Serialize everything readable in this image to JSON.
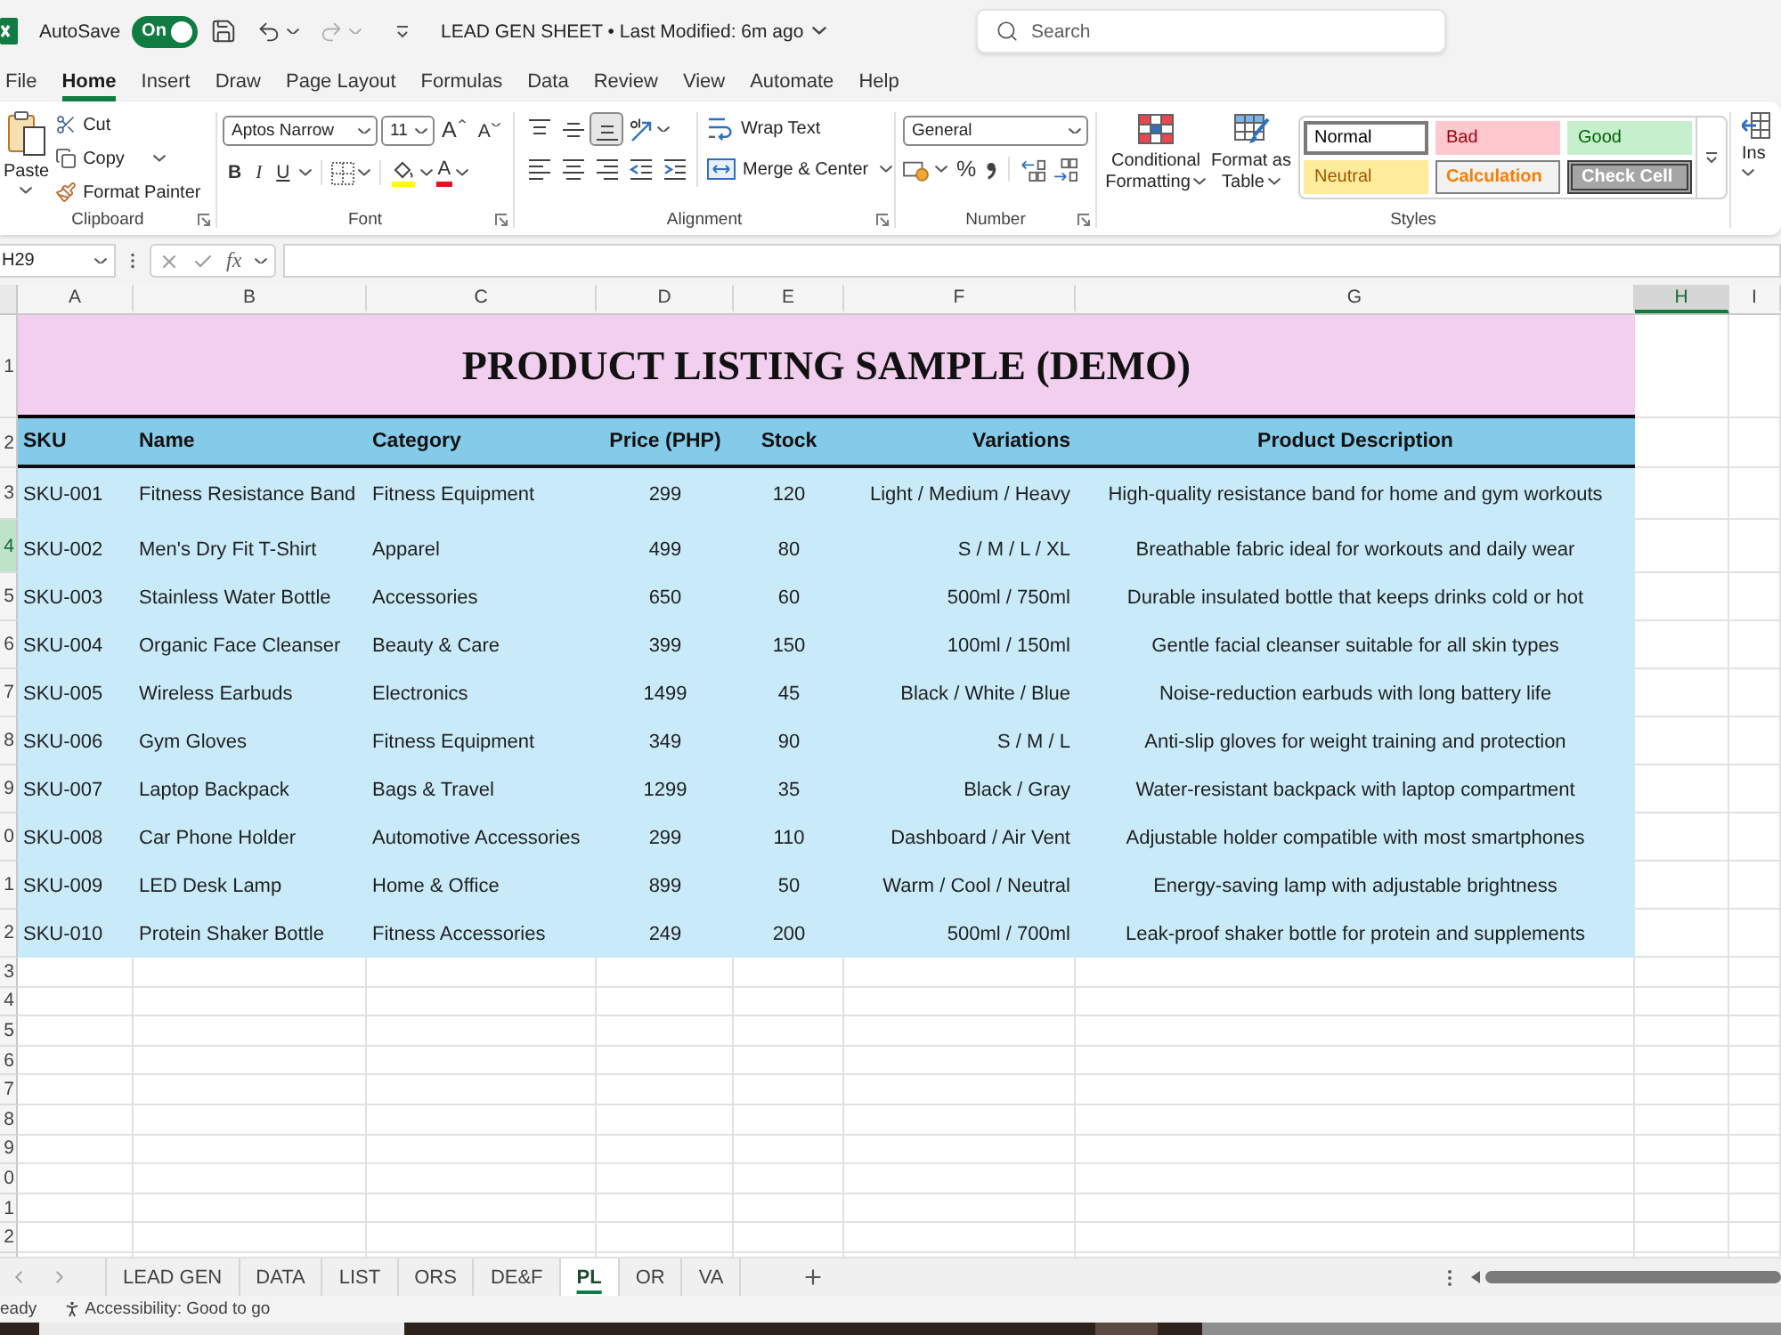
{
  "title_bar": {
    "autosave_label": "AutoSave",
    "autosave": {
      "label": "On",
      "on": true
    },
    "document_title": "LEAD GEN SHEET • Last Modified: 6m ago",
    "search": {
      "placeholder": "Search"
    }
  },
  "menu_tabs": [
    {
      "label": "File",
      "selected": false
    },
    {
      "label": "Home",
      "selected": true
    },
    {
      "label": "Insert",
      "selected": false
    },
    {
      "label": "Draw",
      "selected": false
    },
    {
      "label": "Page Layout",
      "selected": false
    },
    {
      "label": "Formulas",
      "selected": false
    },
    {
      "label": "Data",
      "selected": false
    },
    {
      "label": "Review",
      "selected": false
    },
    {
      "label": "View",
      "selected": false
    },
    {
      "label": "Automate",
      "selected": false
    },
    {
      "label": "Help",
      "selected": false
    }
  ],
  "ribbon": {
    "clipboard": {
      "paste": "Paste",
      "cut": "Cut",
      "copy": "Copy",
      "format_painter": "Format Painter",
      "label": "Clipboard"
    },
    "font": {
      "font_name": "Aptos Narrow",
      "font_size": "11",
      "grow": "A",
      "shrink": "A",
      "text_styles": [
        {
          "kind": "bold",
          "label": "B"
        },
        {
          "kind": "italic",
          "label": "I"
        },
        {
          "kind": "underline",
          "label": "U"
        }
      ],
      "font_color": "A",
      "label": "Font"
    },
    "alignment": {
      "vertical_align": [
        {
          "kind": "top",
          "selected": false
        },
        {
          "kind": "middle",
          "selected": false
        },
        {
          "kind": "bottom",
          "selected": true
        }
      ],
      "wrap_text": "Wrap Text",
      "merge_center": "Merge & Center",
      "label": "Alignment"
    },
    "number": {
      "format": "General",
      "percent": "%",
      "label": "Number"
    },
    "styles": {
      "conditional_formatting": "Conditional Formatting",
      "format_as_table": "Format as Table",
      "cell_styles": [
        {
          "kind": "normal",
          "label": "Normal",
          "selected": true
        },
        {
          "kind": "bad",
          "label": "Bad",
          "selected": false
        },
        {
          "kind": "good",
          "label": "Good",
          "selected": false
        },
        {
          "kind": "neutral",
          "label": "Neutral",
          "selected": false
        },
        {
          "kind": "calculation",
          "label": "Calculation",
          "selected": false
        },
        {
          "kind": "check",
          "label": "Check Cell",
          "selected": false
        }
      ],
      "label": "Styles"
    },
    "insert": {
      "label": "Ins"
    }
  },
  "formula_bar": {
    "name_box": "H29",
    "function_label": "fx"
  },
  "column_headers": [
    {
      "label": "A",
      "selected": false
    },
    {
      "label": "B",
      "selected": false
    },
    {
      "label": "C",
      "selected": false
    },
    {
      "label": "D",
      "selected": false
    },
    {
      "label": "E",
      "selected": false
    },
    {
      "label": "F",
      "selected": false
    },
    {
      "label": "G",
      "selected": false
    },
    {
      "label": "H",
      "selected": true
    },
    {
      "label": "I",
      "selected": false
    }
  ],
  "row_headers": [
    {
      "label": "1",
      "selected": false
    },
    {
      "label": "2",
      "selected": false
    },
    {
      "label": "3",
      "selected": false
    },
    {
      "label": "4",
      "selected": true
    },
    {
      "label": "5",
      "selected": false
    },
    {
      "label": "6",
      "selected": false
    },
    {
      "label": "7",
      "selected": false
    },
    {
      "label": "8",
      "selected": false
    },
    {
      "label": "9",
      "selected": false
    },
    {
      "label": "0",
      "selected": false
    },
    {
      "label": "1",
      "selected": false
    },
    {
      "label": "2",
      "selected": false
    },
    {
      "label": "3",
      "selected": false
    },
    {
      "label": "4",
      "selected": false
    },
    {
      "label": "5",
      "selected": false
    },
    {
      "label": "6",
      "selected": false
    },
    {
      "label": "7",
      "selected": false
    },
    {
      "label": "8",
      "selected": false
    },
    {
      "label": "9",
      "selected": false
    },
    {
      "label": "0",
      "selected": false
    },
    {
      "label": "1",
      "selected": false
    },
    {
      "label": "2",
      "selected": false
    }
  ],
  "sheet": {
    "title": "PRODUCT LISTING SAMPLE (DEMO)",
    "columns": [
      "SKU",
      "Name",
      "Category",
      "Price (PHP)",
      "Stock",
      "Variations",
      "Product Description"
    ],
    "rows": [
      [
        "SKU-001",
        "Fitness Resistance Band",
        "Fitness Equipment",
        "299",
        "120",
        "Light / Medium / Heavy",
        "High-quality resistance band for home and gym workouts"
      ],
      [
        "SKU-002",
        "Men's Dry Fit T-Shirt",
        "Apparel",
        "499",
        "80",
        "S / M / L / XL",
        "Breathable fabric ideal for workouts and daily wear"
      ],
      [
        "SKU-003",
        "Stainless Water Bottle",
        "Accessories",
        "650",
        "60",
        "500ml / 750ml",
        "Durable insulated bottle that keeps drinks cold or hot"
      ],
      [
        "SKU-004",
        "Organic Face Cleanser",
        "Beauty & Care",
        "399",
        "150",
        "100ml / 150ml",
        "Gentle facial cleanser suitable for all skin types"
      ],
      [
        "SKU-005",
        "Wireless Earbuds",
        "Electronics",
        "1499",
        "45",
        "Black / White / Blue",
        "Noise-reduction earbuds with long battery life"
      ],
      [
        "SKU-006",
        "Gym Gloves",
        "Fitness Equipment",
        "349",
        "90",
        "S / M / L",
        "Anti-slip gloves for weight training and protection"
      ],
      [
        "SKU-007",
        "Laptop Backpack",
        "Bags & Travel",
        "1299",
        "35",
        "Black / Gray",
        "Water-resistant backpack with laptop compartment"
      ],
      [
        "SKU-008",
        "Car Phone Holder",
        "Automotive Accessories",
        "299",
        "110",
        "Dashboard / Air Vent",
        "Adjustable holder compatible with most smartphones"
      ],
      [
        "SKU-009",
        "LED Desk Lamp",
        "Home & Office",
        "899",
        "50",
        "Warm / Cool / Neutral",
        "Energy-saving lamp with adjustable brightness"
      ],
      [
        "SKU-010",
        "Protein Shaker Bottle",
        "Fitness Accessories",
        "249",
        "200",
        "500ml / 700ml",
        "Leak-proof shaker bottle for protein and supplements"
      ]
    ]
  },
  "sheet_tabs": [
    {
      "label": "LEAD GEN",
      "selected": false
    },
    {
      "label": "DATA",
      "selected": false
    },
    {
      "label": "LIST",
      "selected": false
    },
    {
      "label": "ORS",
      "selected": false
    },
    {
      "label": "DE&F",
      "selected": false
    },
    {
      "label": "PL",
      "selected": true
    },
    {
      "label": "OR",
      "selected": false
    },
    {
      "label": "VA",
      "selected": false
    }
  ],
  "status_bar": {
    "mode": "eady",
    "accessibility": "Accessibility: Good to go"
  }
}
